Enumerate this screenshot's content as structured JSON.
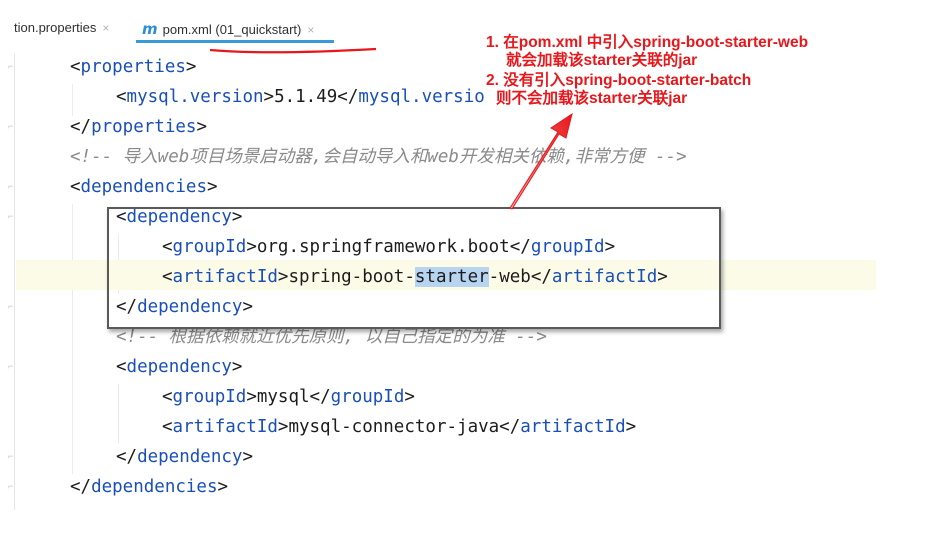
{
  "tabs": [
    {
      "label": "tion.properties",
      "active": false
    },
    {
      "label": "pom.xml (01_quickstart)",
      "active": true,
      "icon": "maven-m-icon"
    }
  ],
  "code_lines": [
    {
      "indent": 0,
      "kind": "xml",
      "tag_open": "<",
      "tag": "properties",
      "tag_close": ">"
    },
    {
      "indent": 1,
      "kind": "xml_inline",
      "open_tag": "mysql.version",
      "text": "5.1.49",
      "close_tag": "mysql.versio"
    },
    {
      "indent": 0,
      "kind": "xml",
      "tag_open": "</",
      "tag": "properties",
      "tag_close": ">"
    },
    {
      "indent": 0,
      "kind": "comment",
      "text": "<!-- 导入web项目场景启动器,会自动导入和web开发相关依赖,非常方便 -->"
    },
    {
      "indent": 0,
      "kind": "xml",
      "tag_open": "<",
      "tag": "dependencies",
      "tag_close": ">"
    },
    {
      "indent": 1,
      "kind": "xml",
      "tag_open": "<",
      "tag": "dependency",
      "tag_close": ">"
    },
    {
      "indent": 2,
      "kind": "xml_inline",
      "open_tag": "groupId",
      "text": "org.springframework.boot",
      "close_tag": "groupId"
    },
    {
      "indent": 2,
      "kind": "xml_inline_sel",
      "open_tag": "artifactId",
      "text_before": "spring-boot-",
      "selected": "starter",
      "text_after": "-web",
      "close_tag": "artifactId"
    },
    {
      "indent": 1,
      "kind": "xml",
      "tag_open": "</",
      "tag": "dependency",
      "tag_close": ">"
    },
    {
      "indent": 1,
      "kind": "comment",
      "text": "<!-- 根据依赖就近优先原则, 以自己指定的为准 -->"
    },
    {
      "indent": 1,
      "kind": "xml",
      "tag_open": "<",
      "tag": "dependency",
      "tag_close": ">"
    },
    {
      "indent": 2,
      "kind": "xml_inline",
      "open_tag": "groupId",
      "text": "mysql",
      "close_tag": "groupId"
    },
    {
      "indent": 2,
      "kind": "xml_inline",
      "open_tag": "artifactId",
      "text": "mysql-connector-java",
      "close_tag": "artifactId"
    },
    {
      "indent": 1,
      "kind": "xml",
      "tag_open": "</",
      "tag": "dependency",
      "tag_close": ">"
    },
    {
      "indent": 0,
      "kind": "xml",
      "tag_open": "</",
      "tag": "dependencies",
      "tag_close": ">"
    }
  ],
  "annotation": {
    "line1": "1. 在pom.xml 中引入spring-boot-starter-web",
    "line2": "就会加载该starter关联的jar",
    "line3": "2. 没有引入spring-boot-starter-batch",
    "line4": "则不会加载该starter关联jar"
  },
  "colors": {
    "tag": "#1a4fb8",
    "comment": "#8a8a8a",
    "annotation": "#e8171b",
    "selection": "#b7d4f1",
    "current_line": "#fbfbe8",
    "tab_underline": "#3a9ad9"
  }
}
